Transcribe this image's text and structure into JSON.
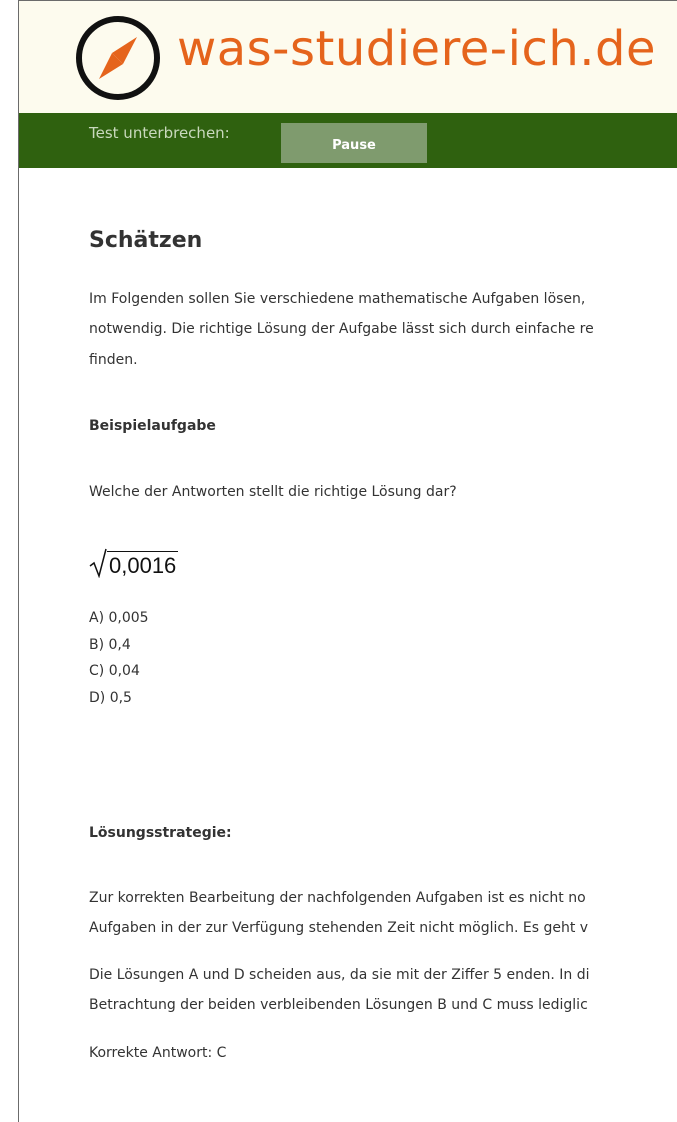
{
  "header": {
    "logo_text": "was-studiere-ich.de",
    "logo_icon": "compass-icon",
    "brand_color": "#e5641c"
  },
  "toolbar": {
    "label": "Test unterbrechen:",
    "pause_label": "Pause",
    "bg_color": "#2f610f"
  },
  "main": {
    "title": "Schätzen",
    "intro": [
      "Im Folgenden sollen Sie verschiedene mathematische Aufgaben lösen,",
      "notwendig. Die richtige Lösung der Aufgabe lässt sich durch einfache re",
      "finden."
    ],
    "example_heading": "Beispielaufgabe",
    "question": "Welche der Antworten stellt die richtige Lösung dar?",
    "formula_value": "0,0016",
    "options": [
      "A) 0,005",
      "B) 0,4",
      "C) 0,04",
      "D) 0,5"
    ],
    "strategy_heading": "Lösungsstrategie:",
    "strategy_p1": [
      "Zur korrekten Bearbeitung der nachfolgenden Aufgaben ist es nicht no",
      "Aufgaben in der zur Verfügung stehenden Zeit nicht möglich. Es geht v"
    ],
    "strategy_p2": [
      "Die Lösungen A und D scheiden aus, da sie mit der Ziffer 5 enden. In di",
      "Betrachtung der beiden verbleibenden Lösungen B und C muss lediglic"
    ],
    "answer": "Korrekte Antwort: C"
  }
}
